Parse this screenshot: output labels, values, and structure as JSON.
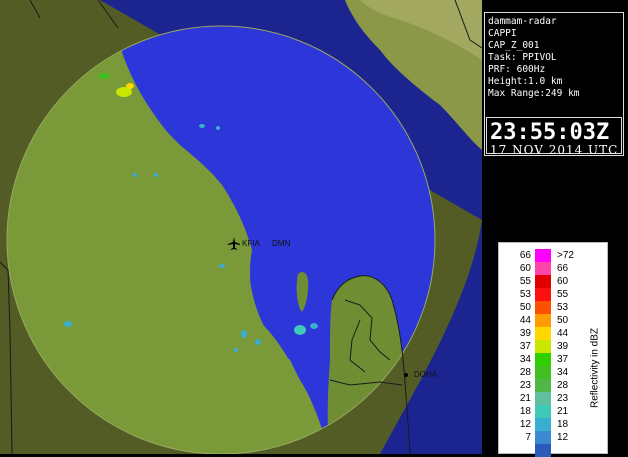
{
  "radar_info": {
    "radar_name": "dammam-radar",
    "product": "CAPPI",
    "product_id": "CAP_Z_001",
    "task": "Task: PPIVOL",
    "prf": "PRF: 600Hz",
    "height": "Height:1.0 km",
    "max_range": "Max Range:249 km",
    "time": "23:55:03Z",
    "date": "17 NOV 2014 UTC"
  },
  "map": {
    "labels": {
      "airport": "KFIA",
      "city_dammam": "DMN",
      "city_doha": "DOHA"
    },
    "colors": {
      "sea": "#2a32dc",
      "land_in_range": "#7a9a3a",
      "land_out_of_range": "#505a22",
      "mountain": "#8c9a4e",
      "border": "#1a1a1a"
    },
    "icons": [
      "airplane-icon"
    ]
  },
  "legend": {
    "axis_label": "Reflectivity in dBZ",
    "rows": [
      {
        "left": "66",
        "right": ">72",
        "color": "#ff00ff"
      },
      {
        "left": "60",
        "right": "66",
        "color": "#ff44aa"
      },
      {
        "left": "55",
        "right": "60",
        "color": "#e00000"
      },
      {
        "left": "53",
        "right": "55",
        "color": "#ff1010"
      },
      {
        "left": "50",
        "right": "53",
        "color": "#ff5000"
      },
      {
        "left": "44",
        "right": "50",
        "color": "#ff9c00"
      },
      {
        "left": "39",
        "right": "44",
        "color": "#ffd800"
      },
      {
        "left": "37",
        "right": "39",
        "color": "#c8e600"
      },
      {
        "left": "34",
        "right": "37",
        "color": "#30d000"
      },
      {
        "left": "28",
        "right": "34",
        "color": "#40c020"
      },
      {
        "left": "23",
        "right": "28",
        "color": "#50b848"
      },
      {
        "left": "21",
        "right": "23",
        "color": "#60bfa0"
      },
      {
        "left": "18",
        "right": "21",
        "color": "#40c8b8"
      },
      {
        "left": "12",
        "right": "18",
        "color": "#3aaed0"
      },
      {
        "left": "7",
        "right": "12",
        "color": "#3a8ad0"
      },
      {
        "left": "",
        "right": "",
        "color": "#2c5ab8"
      }
    ]
  }
}
